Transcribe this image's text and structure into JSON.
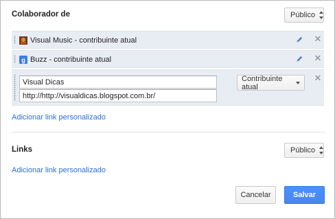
{
  "colaborador": {
    "title": "Colaborador de",
    "visibility": "Público",
    "items": [
      {
        "label": "Visual Music - contribuinte atual",
        "icon": "visual-music-favicon"
      },
      {
        "label": "Buzz - contribuinte atual",
        "icon": "google-buzz-favicon"
      }
    ],
    "edit": {
      "name_value": "Visual Dicas",
      "url_value": "http://http://visualdicas.blogspot.com.br/",
      "role": "Contribuinte atual"
    },
    "add_link": "Adicionar link personalizado"
  },
  "links": {
    "title": "Links",
    "visibility": "Público",
    "add_link": "Adicionar link personalizado"
  },
  "actions": {
    "cancel": "Cancelar",
    "save": "Salvar"
  },
  "colors": {
    "accent": "#4d90fe",
    "link": "#2a6fd6",
    "row_bg": "#e8ecf3"
  }
}
